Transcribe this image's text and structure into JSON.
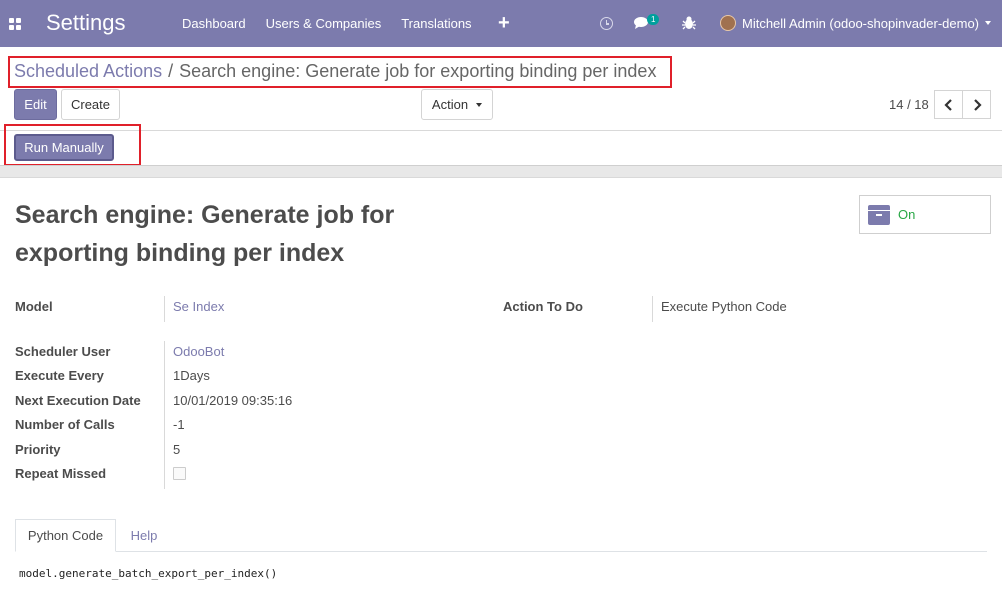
{
  "navbar": {
    "app_title": "Settings",
    "menu": [
      "Dashboard",
      "Users & Companies",
      "Translations"
    ],
    "plus": "+",
    "chat_count": "1",
    "user_name": "Mitchell Admin (odoo-shopinvader-demo)"
  },
  "breadcrumb": {
    "parent": "Scheduled Actions",
    "separator": "/",
    "current": "Search engine: Generate job for exporting binding per index"
  },
  "buttons": {
    "edit": "Edit",
    "create": "Create",
    "action": "Action",
    "run_manually": "Run Manually"
  },
  "pager": {
    "value": "14 / 18"
  },
  "record": {
    "title": "Search engine: Generate job for exporting binding per index",
    "active_label": "On"
  },
  "fields": {
    "model_label": "Model",
    "model_value": "Se Index",
    "action_label": "Action To Do",
    "action_value": "Execute Python Code",
    "user_label": "Scheduler User",
    "user_value": "OdooBot",
    "interval_label": "Execute Every",
    "interval_value": "1Days",
    "nextcall_label": "Next Execution Date",
    "nextcall_value": "10/01/2019 09:35:16",
    "numbercall_label": "Number of Calls",
    "numbercall_value": "-1",
    "priority_label": "Priority",
    "priority_value": "5",
    "repeat_label": "Repeat Missed"
  },
  "tabs": {
    "python_code": "Python Code",
    "help": "Help"
  },
  "code": "model.generate_batch_export_per_index()",
  "colors": {
    "brand": "#7c7bad",
    "highlight": "#e0202a",
    "active_green": "#28a745"
  },
  "icons": [
    "apps-grid-icon",
    "clock-icon",
    "chat-icon",
    "bug-icon",
    "avatar",
    "chevron-left-icon",
    "chevron-right-icon",
    "archive-icon"
  ]
}
